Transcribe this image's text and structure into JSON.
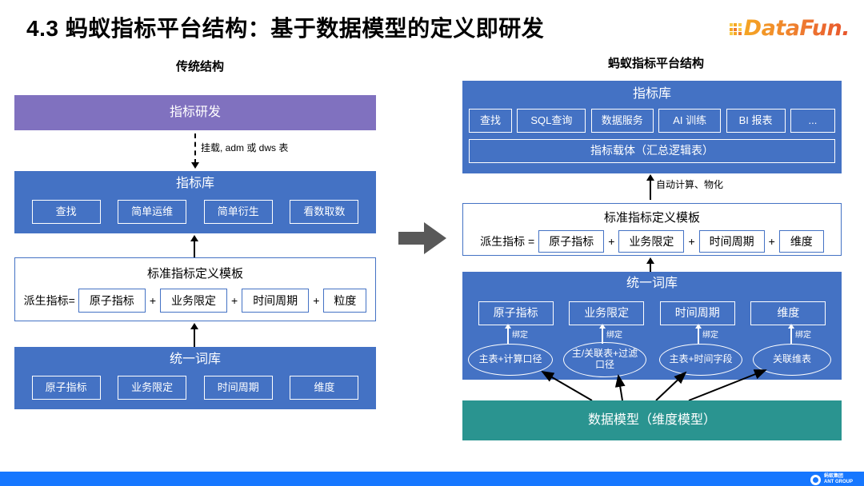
{
  "header": {
    "title": "4.3 蚂蚁指标平台结构：基于数据模型的定义即研发",
    "brand": {
      "name": "DataFun.",
      "colors": [
        "#F5A623",
        "#E8552D"
      ]
    }
  },
  "left_panel": {
    "caption": "传统结构",
    "dev_band": {
      "label": "指标研发",
      "color": "#8071BF"
    },
    "connector_label": "挂载, adm 或 dws 表",
    "metric_store": {
      "title": "指标库",
      "color": "#4472C4",
      "chips": [
        "查找",
        "简单运维",
        "简单衍生",
        "看数取数"
      ]
    },
    "template": {
      "title": "标准指标定义模板",
      "lead": "派生指标=",
      "operator": "+",
      "parts": [
        "原子指标",
        "业务限定",
        "时间周期",
        "粒度"
      ]
    },
    "dictionary": {
      "title": "统一词库",
      "color": "#4472C4",
      "chips": [
        "原子指标",
        "业务限定",
        "时间周期",
        "维度"
      ]
    }
  },
  "right_panel": {
    "caption": "蚂蚁指标平台结构",
    "metric_store": {
      "title": "指标库",
      "color": "#4472C4",
      "chips": [
        "查找",
        "SQL查询",
        "数据服务",
        "AI 训练",
        "BI 报表",
        "..."
      ],
      "carrier": "指标载体（汇总逻辑表）"
    },
    "connector_label": "自动计算、物化",
    "template": {
      "title": "标准指标定义模板",
      "lead": "派生指标 =",
      "operator": "+",
      "parts": [
        "原子指标",
        "业务限定",
        "时间周期",
        "维度"
      ]
    },
    "dictionary": {
      "title": "统一词库",
      "color": "#4472C4",
      "chips": [
        "原子指标",
        "业务限定",
        "时间周期",
        "维度"
      ],
      "bind_label": "绑定",
      "sources": [
        "主表+计算口径",
        "主/关联表+过滤口径",
        "主表+时间字段",
        "关联维表"
      ]
    },
    "data_model": {
      "label": "数据模型（维度模型）",
      "color": "#2A9490"
    }
  },
  "transition_arrow": {
    "name": "right-arrow",
    "color": "#595959"
  },
  "footer": {
    "bar_color": "#1677FF",
    "logo_cn": "蚂蚁集团",
    "logo_en": "ANT GROUP"
  }
}
